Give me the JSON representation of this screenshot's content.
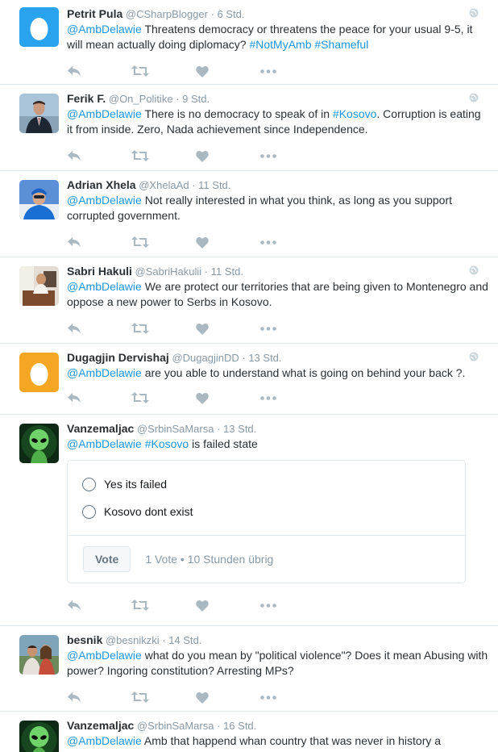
{
  "tweets": [
    {
      "name": "Petrit Pula",
      "handle": "@CSharpBlogger",
      "time": "6 Std.",
      "avatar": "egg",
      "parts": [
        {
          "text": "@AmbDelawie",
          "link": true
        },
        {
          "text": " Threatens democracy or threatens the peace for your usual 9-5, it will mean actually doing diplomacy? ",
          "link": false
        },
        {
          "text": "#NotMyAmb",
          "link": true
        },
        {
          "text": " ",
          "link": false
        },
        {
          "text": "#Shameful",
          "link": true
        }
      ]
    },
    {
      "name": "Ferik F.",
      "handle": "@On_Politike",
      "time": "9 Std.",
      "avatar": "photo-suit",
      "parts": [
        {
          "text": "@AmbDelawie",
          "link": true
        },
        {
          "text": " There is no democracy to speak of in ",
          "link": false
        },
        {
          "text": "#Kosovo",
          "link": true
        },
        {
          "text": ". Corruption is eating it from inside. Zero, Nada achievement since Independence.",
          "link": false
        }
      ]
    },
    {
      "name": "Adrian Xhela",
      "handle": "@XhelaAd",
      "time": "11 Std.",
      "avatar": "photo-blue",
      "parts": [
        {
          "text": "@AmbDelawie",
          "link": true
        },
        {
          "text": " Not really interested in what you think, as long as you support corrupted government.",
          "link": false
        }
      ]
    },
    {
      "name": "Sabri Hakuli",
      "handle": "@SabriHakulii",
      "time": "11 Std.",
      "avatar": "photo-room",
      "parts": [
        {
          "text": "@AmbDelawie",
          "link": true
        },
        {
          "text": " We are protect our territories that are being given to Montenegro and oppose a new power to Serbs in Kosovo.",
          "link": false
        }
      ]
    },
    {
      "name": "Dugagjin Dervishaj",
      "handle": "@DugagjinDD",
      "time": "13 Std.",
      "avatar": "egg-orange",
      "parts": [
        {
          "text": "@AmbDelawie",
          "link": true
        },
        {
          "text": " are you able to understand what is going on behind your back ?.",
          "link": false
        }
      ]
    },
    {
      "name": "Vanzemaljac",
      "handle": "@SrbinSaMarsa",
      "time": "13 Std.",
      "avatar": "alien",
      "parts": [
        {
          "text": "@AmbDelawie",
          "link": true
        },
        {
          "text": " ",
          "link": false
        },
        {
          "text": "#Kosovo",
          "link": true
        },
        {
          "text": " is failed state",
          "link": false
        }
      ],
      "poll": {
        "options": [
          "Yes its failed",
          "Kosovo dont exist"
        ],
        "vote_label": "Vote",
        "meta": "1 Vote • 10 Stunden übrig"
      }
    },
    {
      "name": "besnik",
      "handle": "@besnikzki",
      "time": "14 Std.",
      "avatar": "photo-couple",
      "parts": [
        {
          "text": "@AmbDelawie",
          "link": true
        },
        {
          "text": " what do you mean by \"political violence\"? Does it mean Abusing with power? Ingoring constitution? Arresting MPs?",
          "link": false
        }
      ]
    },
    {
      "name": "Vanzemaljac",
      "handle": "@SrbinSaMarsa",
      "time": "16 Std.",
      "avatar": "alien",
      "parts": [
        {
          "text": "@AmbDelawie",
          "link": true
        },
        {
          "text": " Amb that happend whan country that was never in history a",
          "link": false
        }
      ]
    }
  ],
  "icons": {
    "reply": "reply-icon",
    "retweet": "retweet-icon",
    "like": "heart-icon",
    "more": "more-icon",
    "globe": "globe-icon"
  },
  "colors": {
    "link": "#1b95e0",
    "icon": "#aab8c2",
    "border": "#e1e8ed",
    "egg_blue": "#2aa3ef",
    "egg_orange": "#f5a623"
  }
}
